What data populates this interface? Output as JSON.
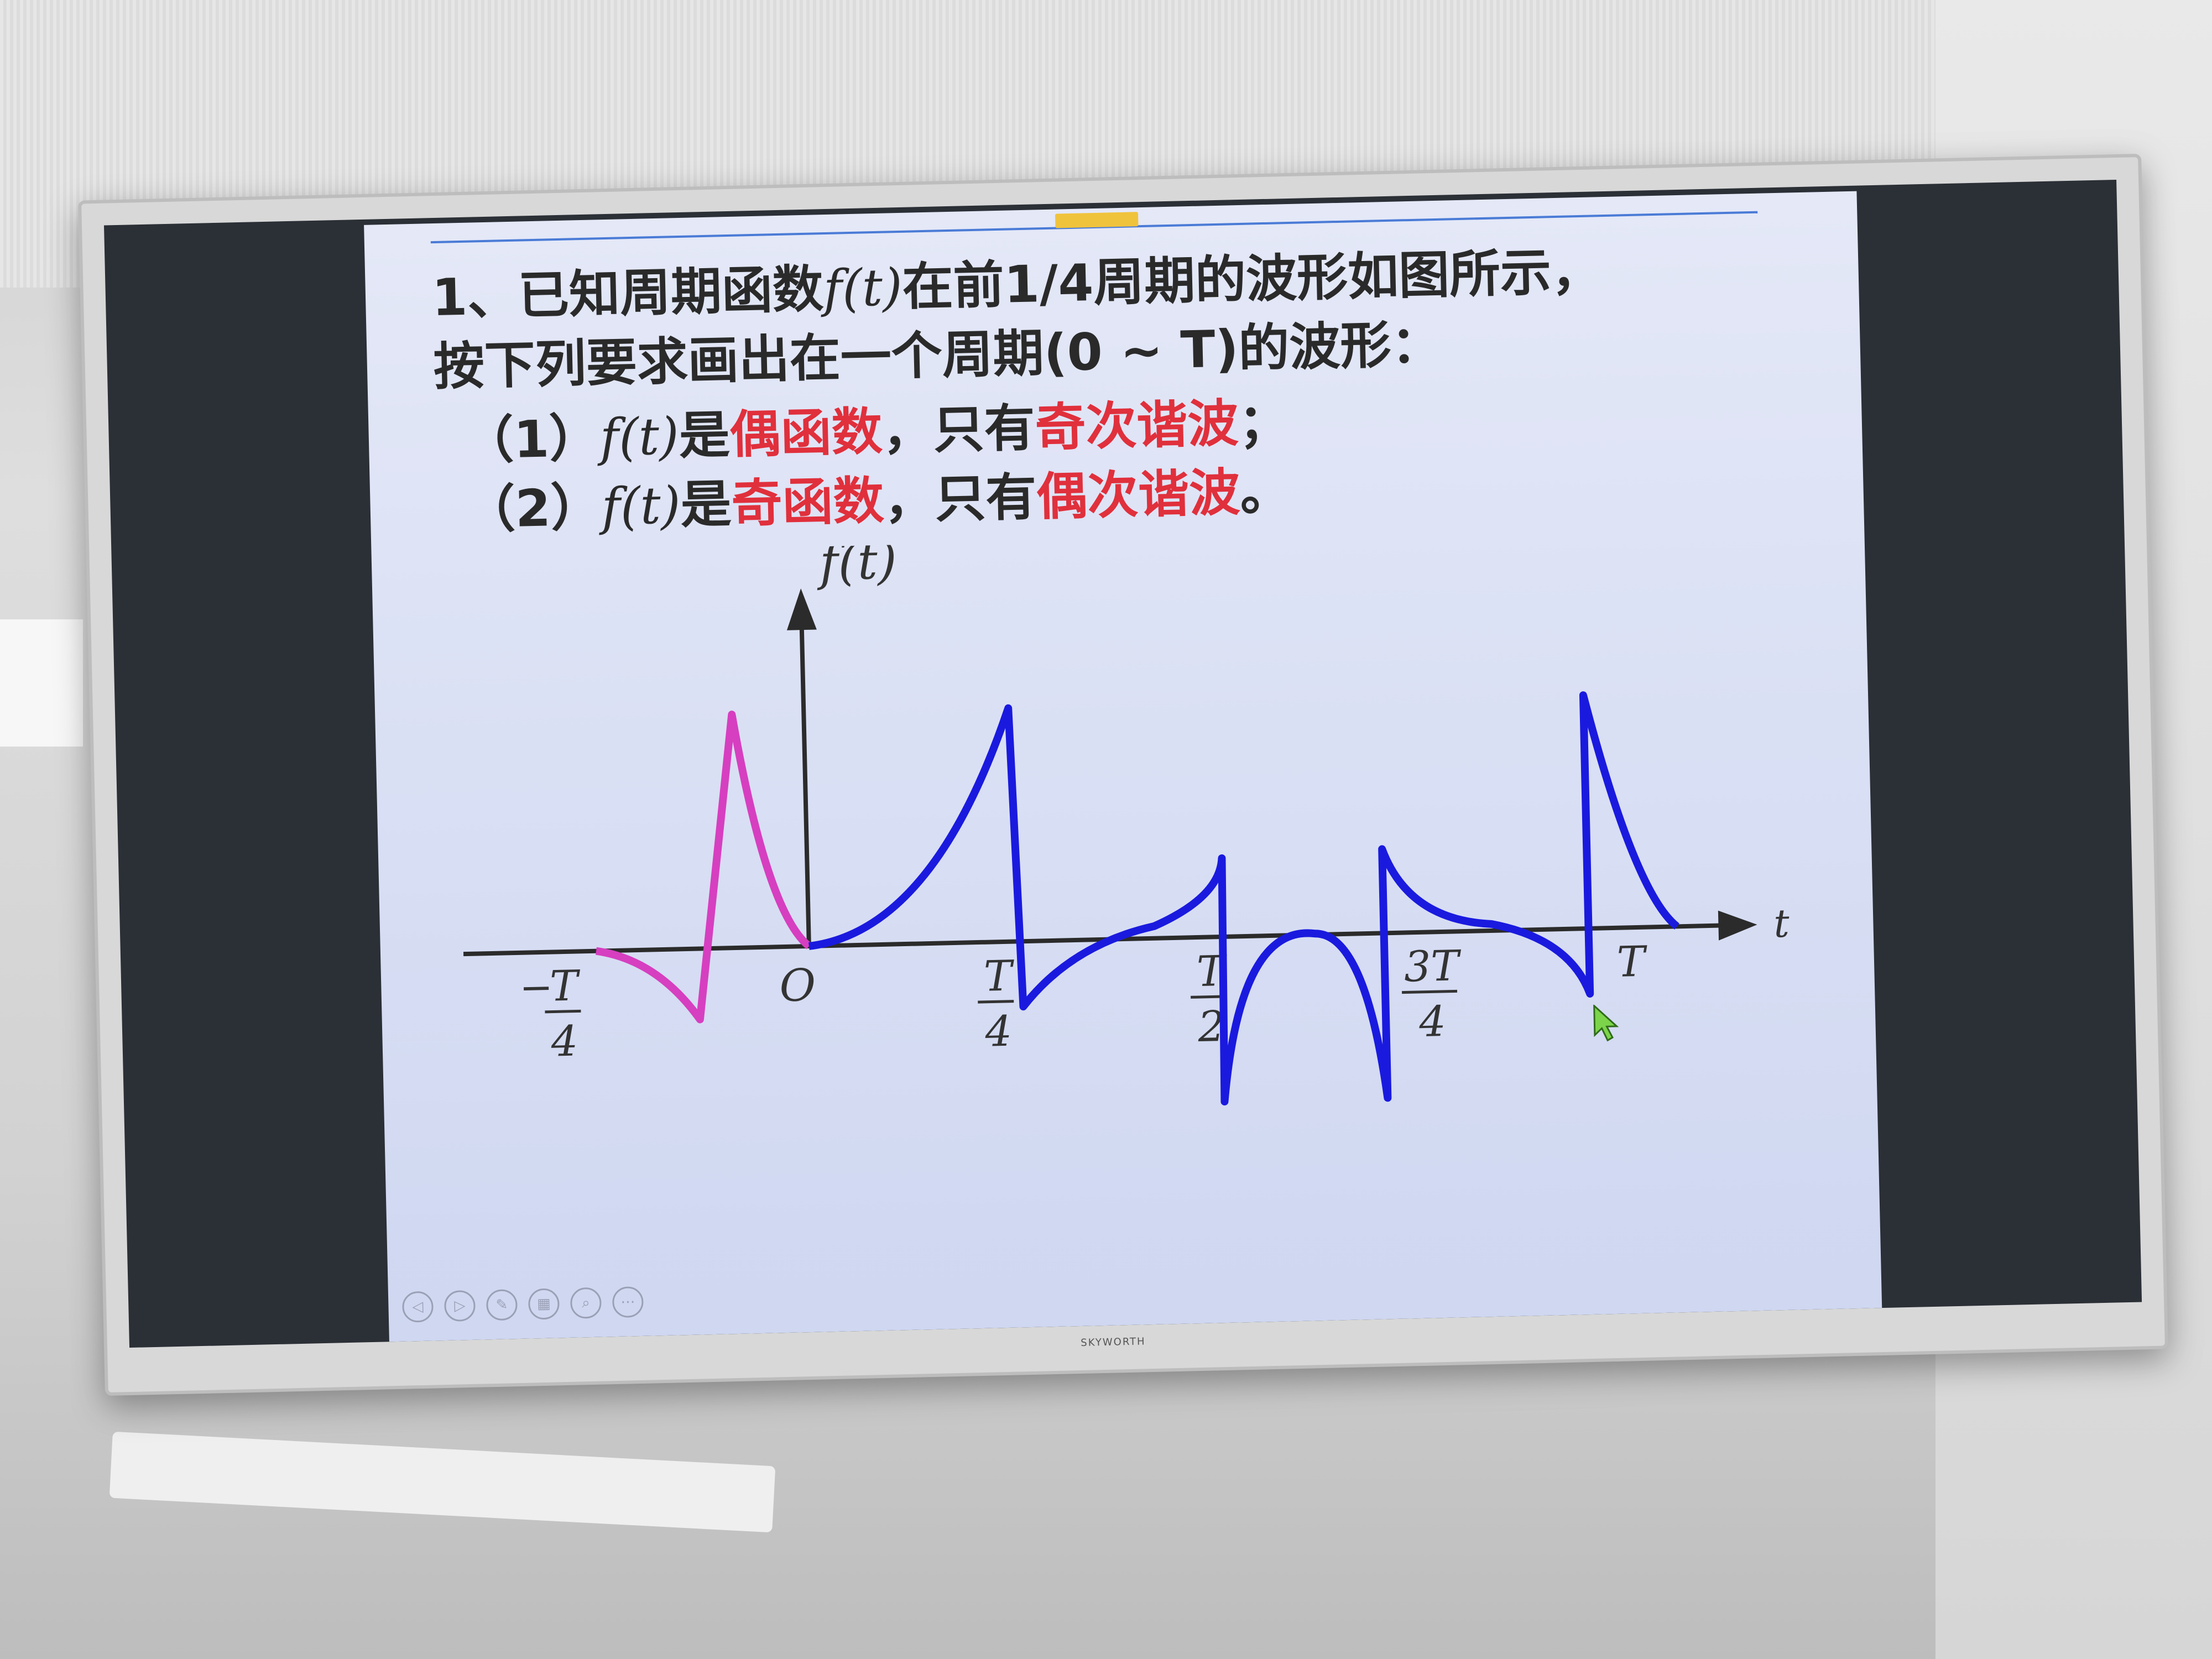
{
  "slide": {
    "line1": {
      "a": "1、已知周期函数",
      "fn": "f(t)",
      "b": "在前1/4周期的波形如图所示，"
    },
    "line2": "按下列要求画出在一个周期(0 ~ T)的波形：",
    "item1": {
      "num": "（1）",
      "fn": "f(t)",
      "a": "是",
      "r1": "偶函数",
      "b": "，只有",
      "r2": "奇次谐波",
      "c": "；"
    },
    "item2": {
      "num": "（2）",
      "fn": "f(t)",
      "a": "是",
      "r1": "奇函数",
      "b": "，只有",
      "r2": "偶次谐波",
      "c": "。"
    }
  },
  "graph": {
    "y_axis_label": "f(t)",
    "x_axis_label": "t",
    "origin_label": "O",
    "ticks": [
      {
        "sign": "−",
        "num": "T",
        "den": "4"
      },
      {
        "num": "T",
        "den": "4"
      },
      {
        "num": "T",
        "den": "2"
      },
      {
        "num": "3T",
        "den": "4"
      },
      {
        "num": "T"
      }
    ],
    "colors": {
      "given_segment": "#d63fc0",
      "drawn_segments": "#1a1adf",
      "axis": "#2b2b2b"
    }
  },
  "toolbar": {
    "icons": [
      "prev-icon",
      "next-icon",
      "pen-icon",
      "grid-icon",
      "zoom-icon",
      "more-icon"
    ],
    "glyphs": [
      "◁",
      "▷",
      "✎",
      "▦",
      "⌕",
      "⋯"
    ]
  },
  "tv": {
    "brand": "SKYWORTH"
  }
}
